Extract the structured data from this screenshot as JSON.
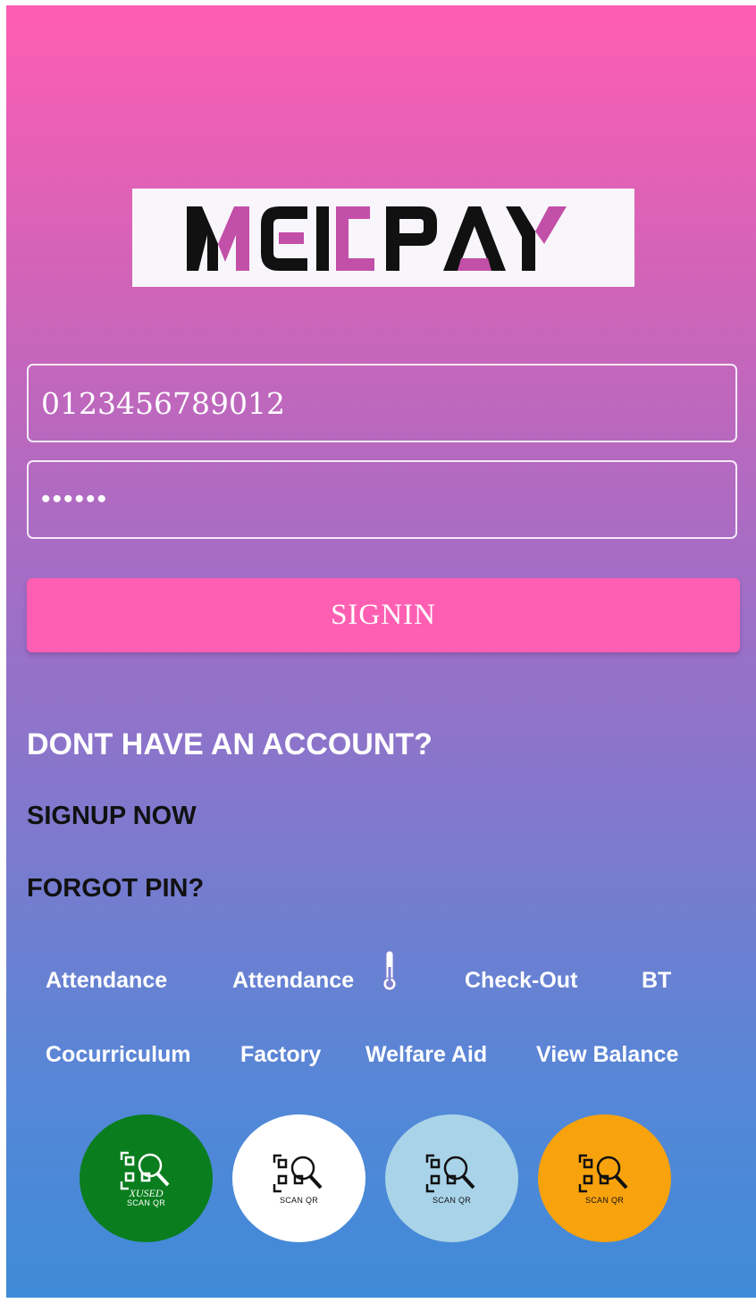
{
  "brand": {
    "logo_text": "MEIDPAY",
    "colors": {
      "dark": "#111111",
      "accent": "#c24fa8"
    }
  },
  "login": {
    "phone_value": "0123456789012",
    "pin_value": "••••••",
    "signin_label": "SIGNIN"
  },
  "account": {
    "question": "DONT HAVE AN ACCOUNT?",
    "signup_label": "SIGNUP NOW",
    "forgot_label": "FORGOT PIN?"
  },
  "menu": {
    "row1": [
      "Attendance",
      "Attendance",
      "Check-Out",
      "BT"
    ],
    "row2": [
      "Cocurriculum",
      "Factory",
      "Welfare Aid",
      "View Balance"
    ]
  },
  "scan_buttons": [
    {
      "caption": "SCAN QR",
      "overlay": "XUSED",
      "color": "#0a7d1e",
      "icon": "qr-search-icon"
    },
    {
      "caption": "SCAN QR",
      "color": "#ffffff",
      "icon": "qr-search-icon"
    },
    {
      "caption": "SCAN QR",
      "color": "#a9d3e8",
      "icon": "qr-search-icon"
    },
    {
      "caption": "SCAN QR",
      "color": "#f8a20e",
      "icon": "qr-search-icon"
    }
  ]
}
